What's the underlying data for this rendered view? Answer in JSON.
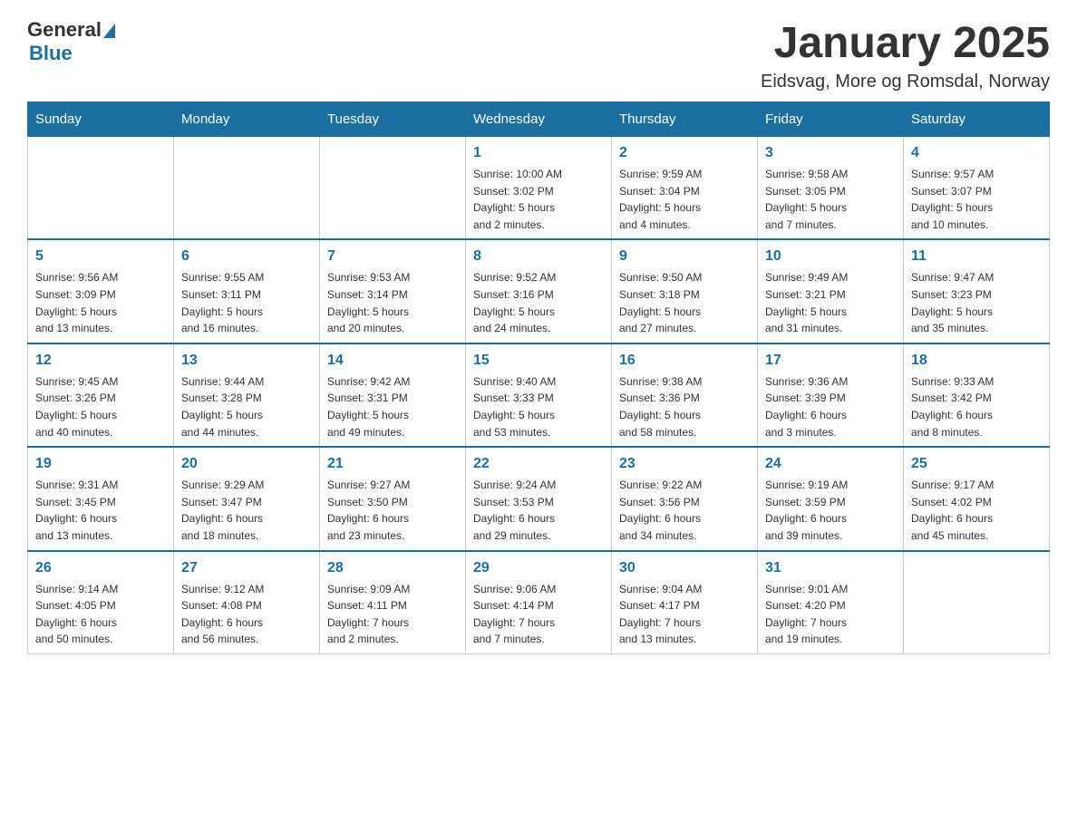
{
  "header": {
    "logo": {
      "general": "General",
      "blue": "Blue"
    },
    "title": "January 2025",
    "location": "Eidsvag, More og Romsdal, Norway"
  },
  "days_of_week": [
    "Sunday",
    "Monday",
    "Tuesday",
    "Wednesday",
    "Thursday",
    "Friday",
    "Saturday"
  ],
  "weeks": [
    [
      {
        "day": "",
        "info": ""
      },
      {
        "day": "",
        "info": ""
      },
      {
        "day": "",
        "info": ""
      },
      {
        "day": "1",
        "info": "Sunrise: 10:00 AM\nSunset: 3:02 PM\nDaylight: 5 hours\nand 2 minutes."
      },
      {
        "day": "2",
        "info": "Sunrise: 9:59 AM\nSunset: 3:04 PM\nDaylight: 5 hours\nand 4 minutes."
      },
      {
        "day": "3",
        "info": "Sunrise: 9:58 AM\nSunset: 3:05 PM\nDaylight: 5 hours\nand 7 minutes."
      },
      {
        "day": "4",
        "info": "Sunrise: 9:57 AM\nSunset: 3:07 PM\nDaylight: 5 hours\nand 10 minutes."
      }
    ],
    [
      {
        "day": "5",
        "info": "Sunrise: 9:56 AM\nSunset: 3:09 PM\nDaylight: 5 hours\nand 13 minutes."
      },
      {
        "day": "6",
        "info": "Sunrise: 9:55 AM\nSunset: 3:11 PM\nDaylight: 5 hours\nand 16 minutes."
      },
      {
        "day": "7",
        "info": "Sunrise: 9:53 AM\nSunset: 3:14 PM\nDaylight: 5 hours\nand 20 minutes."
      },
      {
        "day": "8",
        "info": "Sunrise: 9:52 AM\nSunset: 3:16 PM\nDaylight: 5 hours\nand 24 minutes."
      },
      {
        "day": "9",
        "info": "Sunrise: 9:50 AM\nSunset: 3:18 PM\nDaylight: 5 hours\nand 27 minutes."
      },
      {
        "day": "10",
        "info": "Sunrise: 9:49 AM\nSunset: 3:21 PM\nDaylight: 5 hours\nand 31 minutes."
      },
      {
        "day": "11",
        "info": "Sunrise: 9:47 AM\nSunset: 3:23 PM\nDaylight: 5 hours\nand 35 minutes."
      }
    ],
    [
      {
        "day": "12",
        "info": "Sunrise: 9:45 AM\nSunset: 3:26 PM\nDaylight: 5 hours\nand 40 minutes."
      },
      {
        "day": "13",
        "info": "Sunrise: 9:44 AM\nSunset: 3:28 PM\nDaylight: 5 hours\nand 44 minutes."
      },
      {
        "day": "14",
        "info": "Sunrise: 9:42 AM\nSunset: 3:31 PM\nDaylight: 5 hours\nand 49 minutes."
      },
      {
        "day": "15",
        "info": "Sunrise: 9:40 AM\nSunset: 3:33 PM\nDaylight: 5 hours\nand 53 minutes."
      },
      {
        "day": "16",
        "info": "Sunrise: 9:38 AM\nSunset: 3:36 PM\nDaylight: 5 hours\nand 58 minutes."
      },
      {
        "day": "17",
        "info": "Sunrise: 9:36 AM\nSunset: 3:39 PM\nDaylight: 6 hours\nand 3 minutes."
      },
      {
        "day": "18",
        "info": "Sunrise: 9:33 AM\nSunset: 3:42 PM\nDaylight: 6 hours\nand 8 minutes."
      }
    ],
    [
      {
        "day": "19",
        "info": "Sunrise: 9:31 AM\nSunset: 3:45 PM\nDaylight: 6 hours\nand 13 minutes."
      },
      {
        "day": "20",
        "info": "Sunrise: 9:29 AM\nSunset: 3:47 PM\nDaylight: 6 hours\nand 18 minutes."
      },
      {
        "day": "21",
        "info": "Sunrise: 9:27 AM\nSunset: 3:50 PM\nDaylight: 6 hours\nand 23 minutes."
      },
      {
        "day": "22",
        "info": "Sunrise: 9:24 AM\nSunset: 3:53 PM\nDaylight: 6 hours\nand 29 minutes."
      },
      {
        "day": "23",
        "info": "Sunrise: 9:22 AM\nSunset: 3:56 PM\nDaylight: 6 hours\nand 34 minutes."
      },
      {
        "day": "24",
        "info": "Sunrise: 9:19 AM\nSunset: 3:59 PM\nDaylight: 6 hours\nand 39 minutes."
      },
      {
        "day": "25",
        "info": "Sunrise: 9:17 AM\nSunset: 4:02 PM\nDaylight: 6 hours\nand 45 minutes."
      }
    ],
    [
      {
        "day": "26",
        "info": "Sunrise: 9:14 AM\nSunset: 4:05 PM\nDaylight: 6 hours\nand 50 minutes."
      },
      {
        "day": "27",
        "info": "Sunrise: 9:12 AM\nSunset: 4:08 PM\nDaylight: 6 hours\nand 56 minutes."
      },
      {
        "day": "28",
        "info": "Sunrise: 9:09 AM\nSunset: 4:11 PM\nDaylight: 7 hours\nand 2 minutes."
      },
      {
        "day": "29",
        "info": "Sunrise: 9:06 AM\nSunset: 4:14 PM\nDaylight: 7 hours\nand 7 minutes."
      },
      {
        "day": "30",
        "info": "Sunrise: 9:04 AM\nSunset: 4:17 PM\nDaylight: 7 hours\nand 13 minutes."
      },
      {
        "day": "31",
        "info": "Sunrise: 9:01 AM\nSunset: 4:20 PM\nDaylight: 7 hours\nand 19 minutes."
      },
      {
        "day": "",
        "info": ""
      }
    ]
  ]
}
